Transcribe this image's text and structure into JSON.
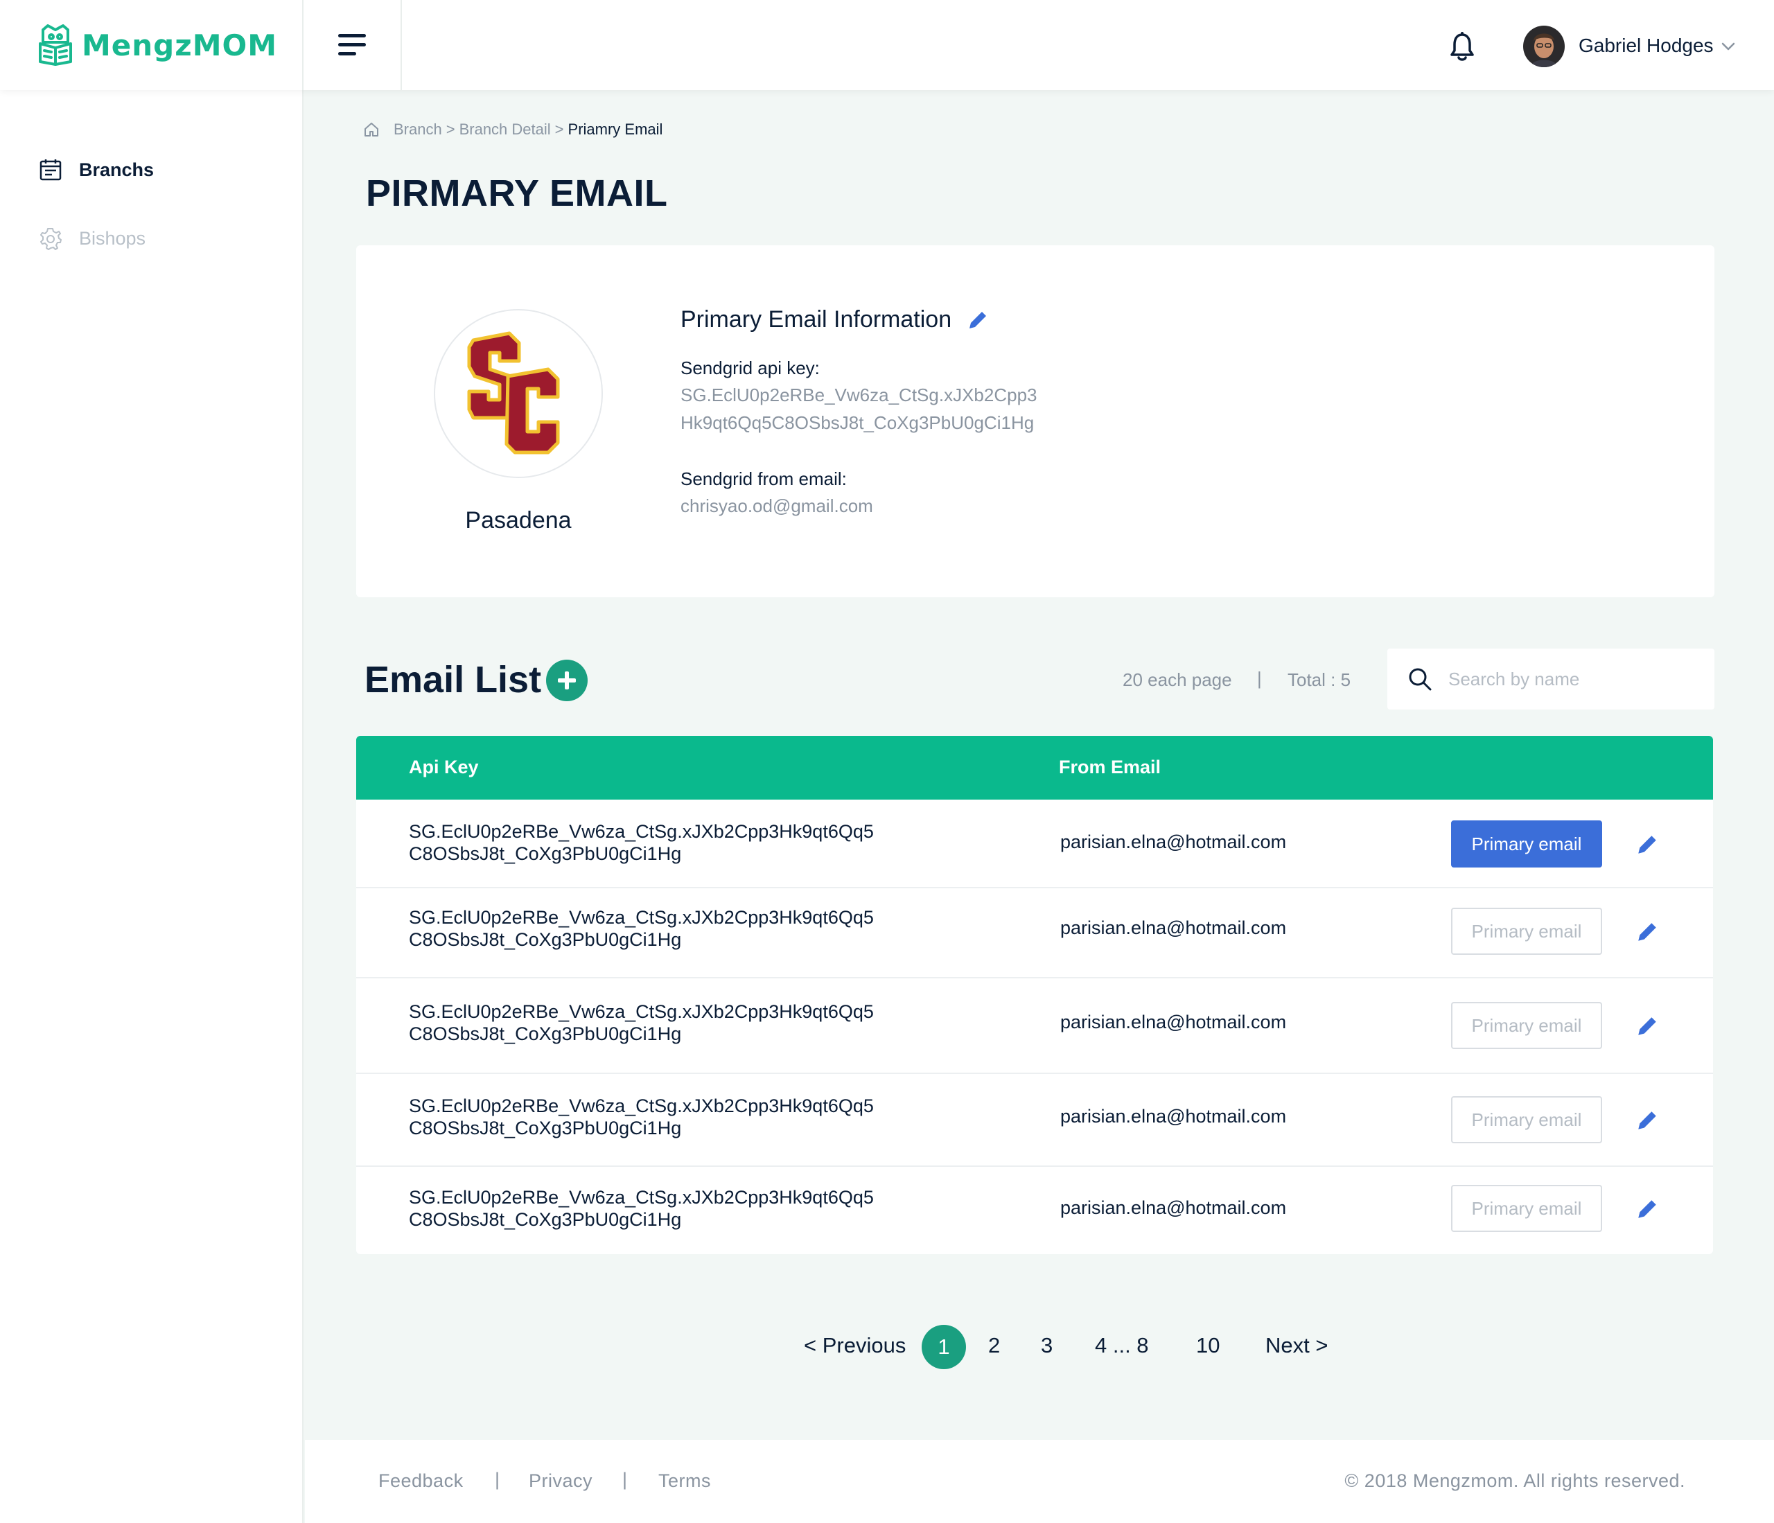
{
  "app": {
    "logo_text": "MengzMOM"
  },
  "header": {
    "user_name": "Gabriel Hodges"
  },
  "sidebar": {
    "items": [
      {
        "label": "Branchs",
        "icon": "calendar-icon",
        "active": true
      },
      {
        "label": "Bishops",
        "icon": "gear-icon",
        "active": false
      }
    ]
  },
  "breadcrumb": {
    "items": [
      "Branch",
      "Branch Detail",
      "Priamry Email"
    ],
    "separator": ">"
  },
  "page_title": "PIRMARY EMAIL",
  "info": {
    "branch_name": "Pasadena",
    "title": "Primary Email Information",
    "api_key_label": "Sendgrid api key:",
    "api_key_line1": "SG.EclU0p2eRBe_Vw6za_CtSg.xJXb2Cpp3",
    "api_key_line2": "Hk9qt6Qq5C8OSbsJ8t_CoXg3PbU0gCi1Hg",
    "from_email_label": "Sendgrid from email:",
    "from_email": "chrisyao.od@gmail.com"
  },
  "email_list": {
    "title": "Email List",
    "per_page": "20 each page",
    "divider": "|",
    "total": "Total : 5",
    "search_placeholder": "Search by name",
    "columns": [
      "Api Key",
      "From Email"
    ],
    "rows": [
      {
        "key1": "SG.EclU0p2eRBe_Vw6za_CtSg.xJXb2Cpp3Hk9qt6Qq5",
        "key2": "C8OSbsJ8t_CoXg3PbU0gCi1Hg",
        "email": "parisian.elna@hotmail.com",
        "button": "Primary email",
        "primary": true
      },
      {
        "key1": "SG.EclU0p2eRBe_Vw6za_CtSg.xJXb2Cpp3Hk9qt6Qq5",
        "key2": "C8OSbsJ8t_CoXg3PbU0gCi1Hg",
        "email": "parisian.elna@hotmail.com",
        "button": "Primary email",
        "primary": false
      },
      {
        "key1": "SG.EclU0p2eRBe_Vw6za_CtSg.xJXb2Cpp3Hk9qt6Qq5",
        "key2": "C8OSbsJ8t_CoXg3PbU0gCi1Hg",
        "email": "parisian.elna@hotmail.com",
        "button": "Primary email",
        "primary": false
      },
      {
        "key1": "SG.EclU0p2eRBe_Vw6za_CtSg.xJXb2Cpp3Hk9qt6Qq5",
        "key2": "C8OSbsJ8t_CoXg3PbU0gCi1Hg",
        "email": "parisian.elna@hotmail.com",
        "button": "Primary email",
        "primary": false
      },
      {
        "key1": "SG.EclU0p2eRBe_Vw6za_CtSg.xJXb2Cpp3Hk9qt6Qq5",
        "key2": "C8OSbsJ8t_CoXg3PbU0gCi1Hg",
        "email": "parisian.elna@hotmail.com",
        "button": "Primary email",
        "primary": false
      }
    ]
  },
  "pagination": {
    "previous": "< Previous",
    "current": "1",
    "pages": [
      "2",
      "3",
      "4 ... 8",
      "10"
    ],
    "next": "Next >"
  },
  "footer": {
    "links": [
      "Feedback",
      "Privacy",
      "Terms"
    ],
    "separator": "|",
    "copyright": "© 2018 Mengzmom. All rights reserved."
  },
  "colors": {
    "brand_green": "#0ab98d",
    "dark_green": "#1a9f80",
    "primary_blue": "#3b6ed9",
    "text_dark": "#0b1d36",
    "text_muted": "#8a94a0",
    "background": "#f2f7f5"
  }
}
